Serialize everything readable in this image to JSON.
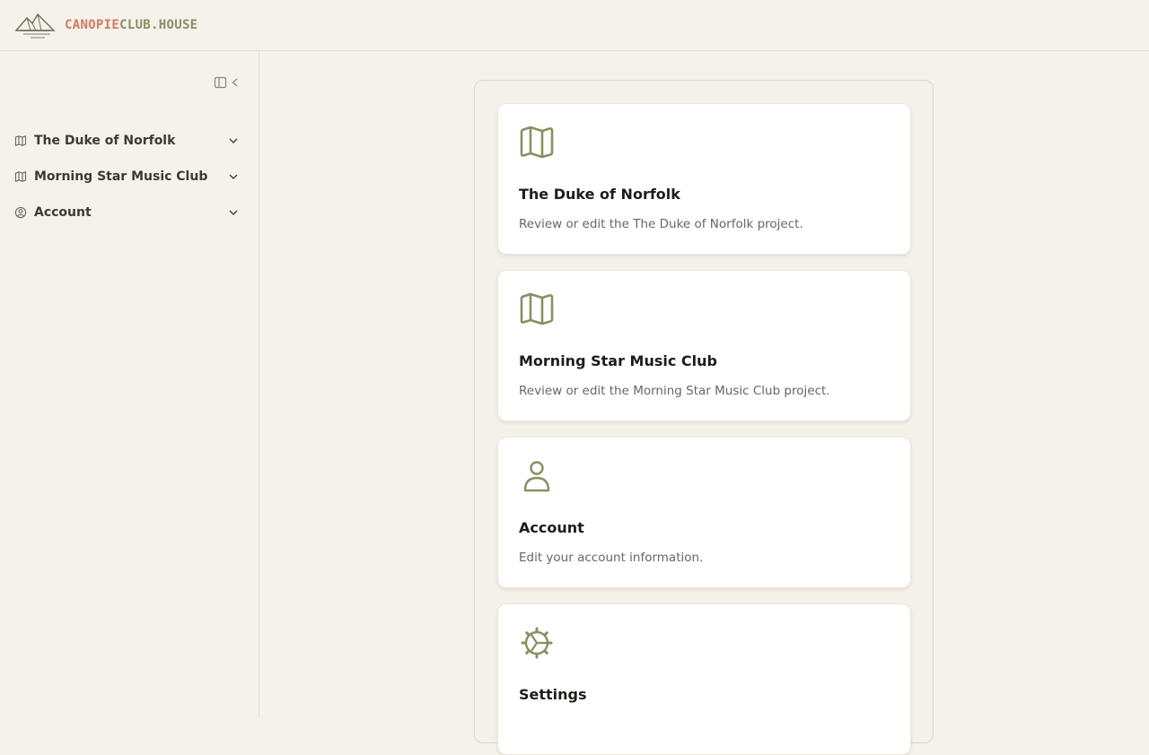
{
  "brand": {
    "part1": "CANOPIE",
    "part2": "CLUB.HOUSE"
  },
  "sidebar": {
    "collapse_icon": "sidebar-collapse-icon",
    "items": [
      {
        "label": "The Duke of Norfolk",
        "icon": "map-icon"
      },
      {
        "label": "Morning Star Music Club",
        "icon": "map-icon"
      },
      {
        "label": "Account",
        "icon": "user-circle-icon"
      }
    ]
  },
  "cards": [
    {
      "title": "The Duke of Norfolk",
      "description": "Review or edit the The Duke of Norfolk project.",
      "icon": "map-icon"
    },
    {
      "title": "Morning Star Music Club",
      "description": "Review or edit the Morning Star Music Club project.",
      "icon": "map-icon"
    },
    {
      "title": "Account",
      "description": "Edit your account information.",
      "icon": "user-icon"
    },
    {
      "title": "Settings",
      "description": "",
      "icon": "gear-icon"
    }
  ],
  "colors": {
    "background": "#f5f1eb",
    "accent_orange": "#d27a5f",
    "accent_olive": "#8a8f63"
  }
}
